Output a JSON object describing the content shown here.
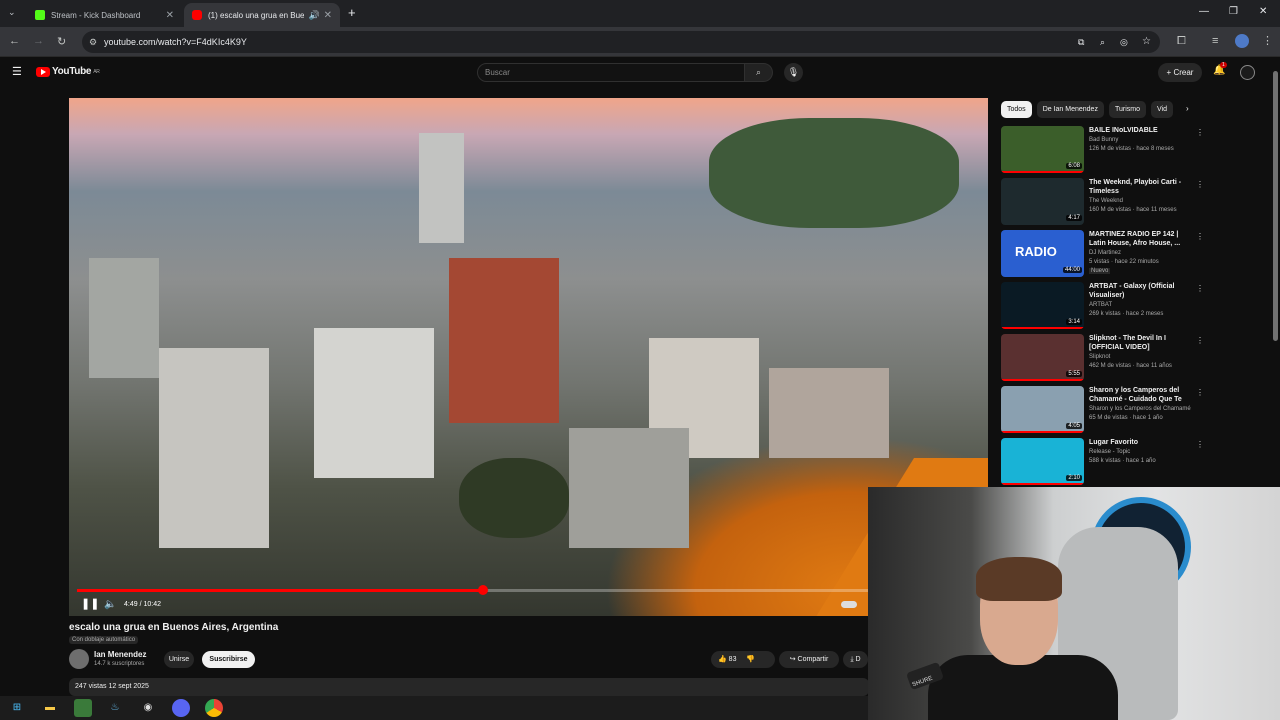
{
  "browser": {
    "tabs": [
      {
        "title": "Stream - Kick Dashboard",
        "active": false
      },
      {
        "title": "(1) escalo una grua en Buen",
        "active": true
      }
    ],
    "url": "youtube.com/watch?v=F4dKIc4K9Y"
  },
  "youtube": {
    "logo_text": "YouTube",
    "region": "AR",
    "search_placeholder": "Buscar",
    "create_label": "Crear",
    "notif_count": "1"
  },
  "player": {
    "time": "4:49 / 10:42",
    "progress_fraction": 0.45
  },
  "video": {
    "title": "escalo una grua en Buenos Aires, Argentina",
    "dub_badge": "Con doblaje automático",
    "channel": "Ian Menendez",
    "subscribers": "14.7 k suscriptores",
    "join_label": "Unirse",
    "subscribe_label": "Suscribirse",
    "likes": "83",
    "share_label": "Compartir",
    "download_label": "D",
    "views_date": "247 vistas  12 sept 2025"
  },
  "sidebar": {
    "chips": [
      "Todos",
      "De Ian Menendez",
      "Turismo",
      "Vid"
    ],
    "recommendations": [
      {
        "title": "BAILE INoLVIDABLE",
        "channel": "Bad Bunny",
        "meta": "126 M de vistas · hace 8 meses",
        "duration": "6:08",
        "color": "#3b5e2a",
        "progress": 1.0
      },
      {
        "title": "The Weeknd, Playboi Carti - Timeless",
        "channel": "The Weeknd",
        "meta": "160 M de vistas · hace 11 meses",
        "duration": "4:17",
        "color": "#1e2a2e",
        "progress": 0.0
      },
      {
        "title": "MARTINEZ RADIO EP 142 | Latin House, Afro House, ...",
        "channel": "DJ Martinez",
        "meta": "5 vistas · hace 22 minutos",
        "duration": "44:00",
        "color": "#2a5fd0",
        "thumb_text": "RADIO",
        "badge": "Nuevo",
        "progress": 0.0
      },
      {
        "title": "ARTBAT - Galaxy (Official Visualiser)",
        "channel": "ARTBAT",
        "meta": "269 k vistas · hace 2 meses",
        "duration": "3:14",
        "color": "#0a1a24",
        "progress": 1.0
      },
      {
        "title": "Slipknot - The Devil In I [OFFICIAL VIDEO]",
        "channel": "Slipknot",
        "meta": "462 M de vistas · hace 11 años",
        "duration": "5:55",
        "color": "#5a3030",
        "progress": 1.0
      },
      {
        "title": "Sharon y los Camperos del Chamamé - Cuidado Que Te ...",
        "channel": "Sharon y los Camperos del Chamamé",
        "meta": "65 M de vistas · hace 1 año",
        "duration": "4:05",
        "color": "#8aa0b0",
        "progress": 1.0
      },
      {
        "title": "Lugar Favorito",
        "channel": "Release - Topic",
        "meta": "588 k vistas · hace 1 año",
        "duration": "2:10",
        "color": "#19b3d6",
        "progress": 1.0
      }
    ]
  },
  "webcam": {
    "mic_label": "SHURE"
  }
}
